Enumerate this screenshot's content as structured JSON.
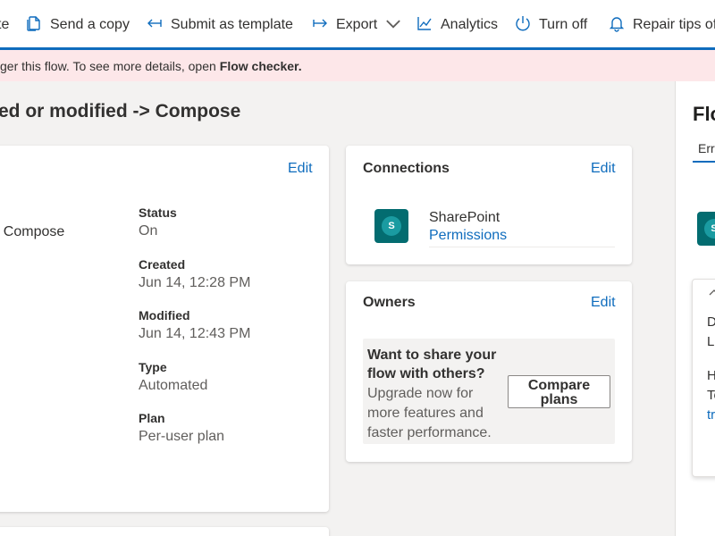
{
  "toolbar": {
    "edit_label": "te",
    "send_copy_label": "Send a copy",
    "submit_template_label": "Submit as template",
    "export_label": "Export",
    "analytics_label": "Analytics",
    "turn_off_label": "Turn off",
    "repair_tips_label": "Repair tips of"
  },
  "banner": {
    "text": "ger this flow. To see more details, open",
    "link": "Flow checker."
  },
  "page_title": "ed or modified -> Compose",
  "details": {
    "edit_label": "Edit",
    "flow_name": "> Compose",
    "fields": [
      {
        "label": "Status",
        "value": "On"
      },
      {
        "label": "Created",
        "value": "Jun 14, 12:28 PM"
      },
      {
        "label": "Modified",
        "value": "Jun 14, 12:43 PM"
      },
      {
        "label": "Type",
        "value": "Automated"
      },
      {
        "label": "Plan",
        "value": "Per-user plan"
      }
    ]
  },
  "connections": {
    "title": "Connections",
    "edit_label": "Edit",
    "items": [
      {
        "name": "SharePoint",
        "link": "Permissions",
        "icon": "sharepoint-icon"
      }
    ]
  },
  "owners": {
    "title": "Owners",
    "edit_label": "Edit",
    "upsell_title": "Want to share your flow with others?",
    "upsell_text": "Upgrade now for more features and faster performance.",
    "compare_button": "Compare plans"
  },
  "right_panel": {
    "title": "Flo",
    "tab": "Err",
    "card_chevron": "chevron-up-icon",
    "lines": [
      "D",
      "La",
      "H",
      "To",
      "tr"
    ]
  },
  "colors": {
    "accent": "#0f6cbd",
    "banner_bg": "#fde7e9",
    "sharepoint": "#036c70"
  }
}
